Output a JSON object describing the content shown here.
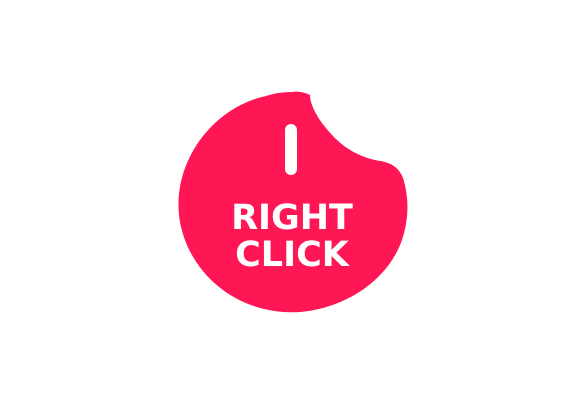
{
  "brand": {
    "line1": "RIGHT",
    "line2": "CLICK",
    "color": "#FF1654",
    "text_color": "#FFFFFF",
    "icon": "mouse-scroll-wheel-icon"
  },
  "background": "#FFFFFF"
}
